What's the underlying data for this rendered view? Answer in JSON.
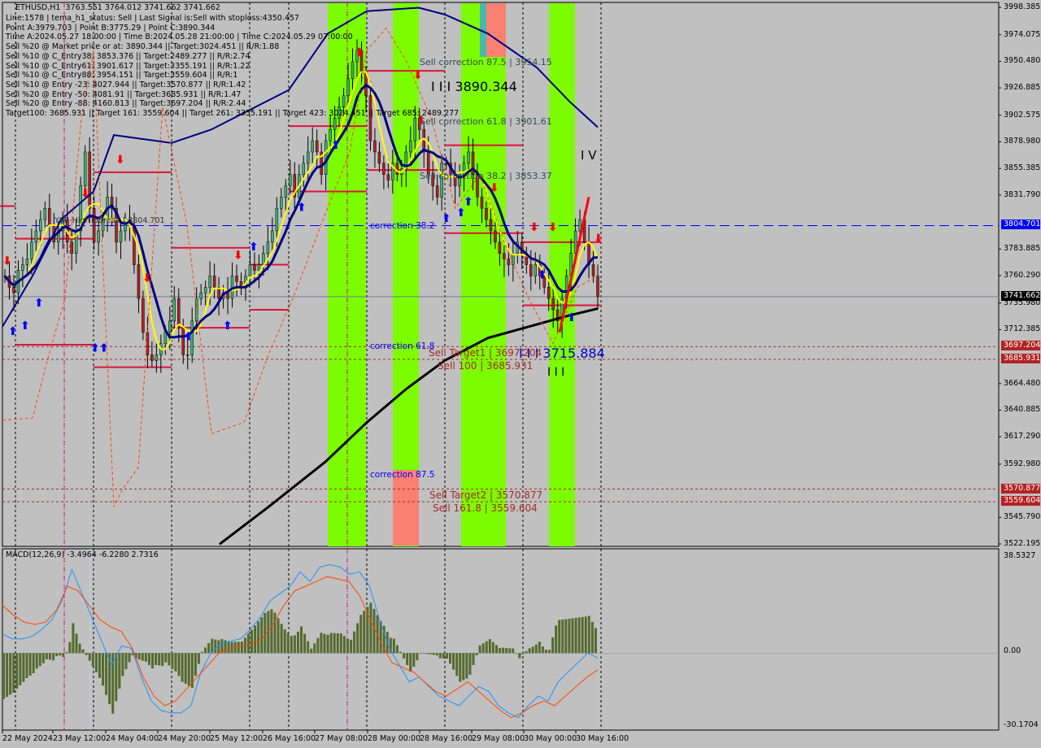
{
  "header": {
    "title": "ETHUSD,H1",
    "ohlc": "3763.551 3764.012 3741.662 3741.662",
    "lines": [
      "Line:1578 | tema_h1_status: Sell | Last Signal is:Sell with stoploss:4350.457",
      "Point A:3979.703 | Point B:3775.29 | Point C:3890.344",
      "Time A:2024.05.27 18:00:00 | Time B:2024.05.28 21:00:00 | Time C:2024.05.29 07:00:00",
      "Sell %20 @ Market price or at: 3890.344 || Target:3024.451 || R/R:1.88",
      "Sell %10 @ C_Entry38: 3853.376 || Target:2489.277 || R/R:2.74",
      "Sell %10 @ C_Entry61: 3901.617 || Target:3355.191 || R/R:1.22",
      "Sell %10 @ C_Entry88: 3954.151 || Target:3559.604 || R/R:1",
      "Sell %10 @ Entry -23: 4027.944 || Target:3570.877 || R/R:1.42",
      "Sell %20 @ Entry -50: 4081.91 || Target:3685.931 || R/R:1.47",
      "Sell %20 @ Entry -88: 4160.813 || Target:3697.204 || R/R:2.44",
      "Target100: 3685.931 || Target 161: 3559.604 || Target 261: 3355.191 || Target 423: 3024.451 || Target 685: 2489.277"
    ]
  },
  "chart_data": [
    {
      "type": "candlestick",
      "title": "ETHUSD,H1",
      "symbol": "ETHUSD",
      "timeframe": "H1",
      "ylim": [
        3522.195,
        3998.385
      ],
      "y_ticks": [
        3998.385,
        3974.075,
        3950.48,
        3926.885,
        3902.575,
        3878.98,
        3855.385,
        3831.79,
        3804.701,
        3783.885,
        3760.29,
        3741.662,
        3735.98,
        3712.385,
        3697.204,
        3685.931,
        3664.48,
        3640.885,
        3617.29,
        3592.98,
        3570.877,
        3559.604,
        3545.79,
        3522.195
      ],
      "x_ticks": [
        "22 May 2024",
        "23 May 12:00",
        "24 May 04:00",
        "24 May 20:00",
        "25 May 12:00",
        "26 May 16:00",
        "27 May 08:00",
        "28 May 00:00",
        "28 May 16:00",
        "29 May 08:00",
        "30 May 00:00",
        "30 May 16:00"
      ],
      "price_tags": [
        {
          "value": "3804.701",
          "color": "#0000ff"
        },
        {
          "value": "3741.662",
          "color": "#000000"
        },
        {
          "value": "3697.204",
          "color": "#b22222"
        },
        {
          "value": "3685.931",
          "color": "#b22222"
        },
        {
          "value": "3570.877",
          "color": "#b22222"
        },
        {
          "value": "3559.604",
          "color": "#b22222"
        }
      ],
      "close_path": [
        3760,
        3750,
        3745,
        3765,
        3770,
        3775,
        3790,
        3800,
        3810,
        3820,
        3805,
        3790,
        3800,
        3810,
        3790,
        3780,
        3800,
        3840,
        3870,
        3820,
        3790,
        3800,
        3810,
        3830,
        3820,
        3790,
        3800,
        3810,
        3805,
        3770,
        3740,
        3710,
        3690,
        3685,
        3690,
        3700,
        3710,
        3720,
        3740,
        3715,
        3690,
        3690,
        3720,
        3740,
        3745,
        3750,
        3760,
        3750,
        3740,
        3745,
        3740,
        3760,
        3755,
        3750,
        3760,
        3770,
        3765,
        3770,
        3780,
        3790,
        3800,
        3820,
        3830,
        3840,
        3850,
        3830,
        3850,
        3860,
        3870,
        3880,
        3870,
        3850,
        3880,
        3890,
        3900,
        3910,
        3920,
        3935,
        3950,
        3960,
        3940,
        3920,
        3880,
        3870,
        3860,
        3850,
        3845,
        3860,
        3850,
        3855,
        3870,
        3880,
        3900,
        3890,
        3870,
        3850,
        3840,
        3830,
        3860,
        3860,
        3850,
        3840,
        3850,
        3860,
        3870,
        3850,
        3830,
        3820,
        3810,
        3800,
        3790,
        3780,
        3775,
        3770,
        3780,
        3790,
        3780,
        3770,
        3760,
        3770,
        3760,
        3750,
        3740,
        3730,
        3720,
        3740,
        3760,
        3780,
        3800,
        3810,
        3790,
        3770,
        3760,
        3741.662
      ],
      "series": [
        {
          "name": "fast-ma",
          "color": "#ffff00"
        },
        {
          "name": "slow-ma",
          "color": "#000080"
        },
        {
          "name": "ma-200",
          "color": "#000000"
        },
        {
          "name": "upper-band",
          "color": "#000080"
        }
      ],
      "horizontal_lines": [
        {
          "name": "yesterday-high-to-break",
          "label": "YSB-HighToBreak | 3804.701",
          "value": 3804.701,
          "style": "dashed",
          "color": "#0000ff"
        },
        {
          "name": "sell-target1",
          "label": "Sell Target1 | 3697.204",
          "value": 3697.204,
          "style": "dotted",
          "color": "#a52a2a"
        },
        {
          "name": "sell-100",
          "label": "Sell 100 | 3685.931",
          "value": 3685.931,
          "style": "dotted",
          "color": "#a52a2a"
        },
        {
          "name": "sell-target2",
          "label": "Sell Target2 | 3570.877",
          "value": 3570.877,
          "style": "dotted",
          "color": "#a52a2a"
        },
        {
          "name": "sell-161",
          "label": "Sell 161.8 | 3559.604",
          "value": 3559.604,
          "style": "dotted",
          "color": "#a52a2a"
        }
      ],
      "annotations": [
        {
          "text": "Sell correction 87.5 | 3954.15",
          "color": "#333333"
        },
        {
          "text": "I I I 3890.344",
          "color": "#000000"
        },
        {
          "text": "Sell correction 61.8 | 3901.61",
          "color": "#333333"
        },
        {
          "text": "Sell correction 38.2 | 3853.37",
          "color": "#333333"
        },
        {
          "text": "I V",
          "color": "#000000"
        },
        {
          "text": "correction 38.2",
          "color": "#0000ff"
        },
        {
          "text": "correction 61.8",
          "color": "#0000ff"
        },
        {
          "text": "correction 87.5",
          "color": "#0000ff"
        },
        {
          "text": "I I I 3715.884",
          "color": "#0000ff"
        },
        {
          "text": "I I I",
          "color": "#000000"
        }
      ]
    },
    {
      "type": "macd",
      "title": "MACD(12,26,9) -3.4964 -6.2280 2.7316",
      "params": [
        12,
        26,
        9
      ],
      "values": {
        "main": -3.4964,
        "signal": -6.228,
        "histogram": 2.7316
      },
      "ylim": [
        -30.1704,
        38.5327
      ],
      "y_ticks": [
        "38.5327",
        "0.00",
        "-30.1704"
      ],
      "series": [
        {
          "name": "macd-line",
          "color": "#1e90ff",
          "values": [
            8,
            6,
            6,
            7,
            10,
            14,
            22,
            35,
            25,
            15,
            5,
            -5,
            3,
            2,
            -10,
            -20,
            -24,
            -25,
            -25,
            -22,
            -8,
            0,
            4,
            5,
            6,
            10,
            15,
            22,
            25,
            28,
            34,
            30,
            36,
            37,
            36,
            33,
            34,
            28,
            14,
            2,
            -5,
            -12,
            -10,
            -14,
            -18,
            -20,
            -22,
            -18,
            -14,
            -16,
            -22,
            -25,
            -27,
            -22,
            -18,
            -20,
            -12,
            -8,
            -4,
            0,
            -2
          ],
          "note": "approximate shape read from plot"
        },
        {
          "name": "signal-line",
          "color": "#ff4500",
          "values": [
            20,
            16,
            13,
            12,
            13,
            18,
            28,
            26,
            20,
            14,
            11,
            9,
            2,
            -10,
            -18,
            -22,
            -20,
            -15,
            -10,
            -5,
            0,
            2,
            3,
            4,
            6,
            12,
            20,
            26,
            28,
            30,
            32,
            31,
            30,
            24,
            14,
            4,
            -4,
            -6,
            -8,
            -12,
            -16,
            -18,
            -15,
            -12,
            -16,
            -20,
            -24,
            -27,
            -25,
            -22,
            -20,
            -22,
            -18,
            -14,
            -10,
            -7
          ],
          "note": "approximate shape read from plot"
        },
        {
          "name": "histogram",
          "color": "#556b2f"
        }
      ]
    }
  ],
  "axis": {
    "price_labels": [
      "3998.385",
      "3974.075",
      "3950.480",
      "3926.885",
      "3902.575",
      "3878.980",
      "3855.385",
      "3831.790",
      "3783.885",
      "3760.290",
      "3735.980",
      "3712.385",
      "3664.480",
      "3640.885",
      "3617.290",
      "3592.980",
      "3545.790",
      "3522.195"
    ],
    "macd_labels": [
      "38.5327",
      "0.00",
      "-30.1704"
    ]
  },
  "colors": {
    "background": "#c0c0c0",
    "bull_candle": "#3cb371",
    "bear_candle": "#b22222",
    "green_zone": "#7cfc00",
    "red_zone": "#fa8072",
    "teal_zone": "#48b8b0",
    "sell_arrow": "#ff0000",
    "buy_arrow": "#0000ff",
    "level_line": "#dc143c"
  }
}
